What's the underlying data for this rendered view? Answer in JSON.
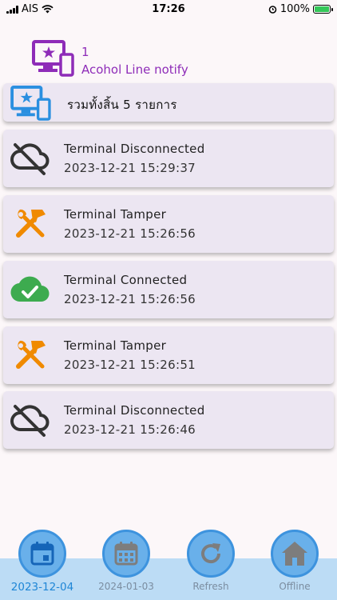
{
  "status_bar": {
    "carrier": "AIS",
    "time": "17:26",
    "battery": "100%"
  },
  "header": {
    "count": "1",
    "title": "Acohol Line notify",
    "icon": "monitor-phone-star-icon"
  },
  "summary": {
    "text": "รวมทั้งสิ้น  5  รายการ",
    "icon": "monitor-phone-star-icon"
  },
  "events": [
    {
      "title": "Terminal Disconnected",
      "time": "2023-12-21 15:29:37",
      "icon": "cloud-off-icon"
    },
    {
      "title": "Terminal Tamper",
      "time": "2023-12-21 15:26:56",
      "icon": "tools-icon"
    },
    {
      "title": "Terminal Connected",
      "time": "2023-12-21 15:26:56",
      "icon": "cloud-check-icon"
    },
    {
      "title": "Terminal Tamper",
      "time": "2023-12-21 15:26:51",
      "icon": "tools-icon"
    },
    {
      "title": "Terminal Disconnected",
      "time": "2023-12-21 15:26:46",
      "icon": "cloud-off-icon"
    }
  ],
  "nav": [
    {
      "label": "2023-12-04",
      "icon": "calendar-icon",
      "active": true
    },
    {
      "label": "2024-01-03",
      "icon": "calendar-icon",
      "active": false
    },
    {
      "label": "Refresh",
      "icon": "refresh-icon",
      "active": false
    },
    {
      "label": "Offline",
      "icon": "home-icon",
      "active": false
    }
  ],
  "colors": {
    "accent_purple": "#8e2cb8",
    "accent_blue": "#2a8fe0",
    "tools_orange": "#f08a00",
    "connected_green": "#3dab4f",
    "nav_circle": "#69b0ea"
  }
}
